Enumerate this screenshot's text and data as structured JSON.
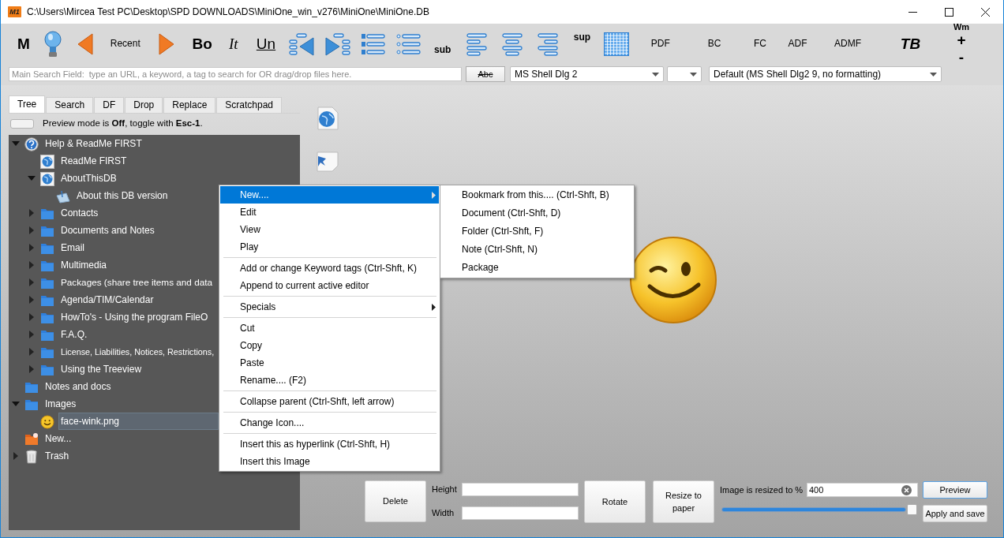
{
  "window": {
    "logo": "M1",
    "title": "C:\\Users\\Mircea Test PC\\Desktop\\SPD DOWNLOADS\\MiniOne_win_v276\\MiniOne\\MiniOne.DB"
  },
  "toolbar": {
    "buttons": [
      "M",
      "Recent",
      "Bo",
      "It",
      "Un",
      "sub",
      "sup",
      "PDF",
      "BC",
      "FC",
      "ADF",
      "ADMF",
      "TB",
      "Wm",
      "+",
      "-"
    ]
  },
  "search": {
    "placeholder": "Main Search Field:  type an URL, a keyword, a tag to search for OR drag/drop files here."
  },
  "format_bar": {
    "clear_button": "Abc",
    "font": "MS Shell Dlg 2",
    "style": "Default (MS Shell Dlg2 9, no formatting)"
  },
  "tabs": [
    {
      "label": "Tree",
      "selected": true
    },
    {
      "label": "Search",
      "selected": false
    },
    {
      "label": "DF",
      "selected": false
    },
    {
      "label": "Drop",
      "selected": false
    },
    {
      "label": "Replace",
      "selected": false
    },
    {
      "label": "Scratchpad",
      "selected": false
    }
  ],
  "preview": {
    "on": false,
    "text": "Preview mode is **Off**, toggle with **Esc-1**."
  },
  "tree": [
    {
      "label": "Help & ReadMe FIRST",
      "kind": "help",
      "selected": false,
      "expanded": true,
      "children": [
        {
          "label": "ReadMe FIRST",
          "kind": "web",
          "selected": false
        },
        {
          "label": "AboutThisDB",
          "kind": "web",
          "selected": false,
          "expanded": true,
          "children": [
            {
              "label": "About this DB version",
              "kind": "note",
              "selected": false
            }
          ]
        },
        {
          "label": "Contacts",
          "kind": "folder",
          "selected": false,
          "expanded": false
        },
        {
          "label": "Documents and Notes",
          "kind": "folder",
          "selected": false,
          "expanded": false
        },
        {
          "label": "Email",
          "kind": "folder",
          "selected": false,
          "expanded": false
        },
        {
          "label": "Multimedia",
          "kind": "folder",
          "selected": false,
          "expanded": false
        },
        {
          "label": "Packages (share tree items and data",
          "kind": "folder",
          "selected": false,
          "expanded": false
        },
        {
          "label": "Agenda/TIM/Calendar",
          "kind": "folder",
          "selected": false,
          "expanded": false
        },
        {
          "label": "HowTo's - Using the program FileO",
          "kind": "folder",
          "selected": false,
          "expanded": false
        },
        {
          "label": "F.A.Q.",
          "kind": "folder",
          "selected": false,
          "expanded": false
        },
        {
          "label": "License, Liabilities, Notices, Restrictions,",
          "kind": "folder",
          "selected": false,
          "expanded": false
        },
        {
          "label": "Using the Treeview",
          "kind": "folder",
          "selected": false,
          "expanded": false
        }
      ]
    },
    {
      "label": "Notes and docs",
      "kind": "folder",
      "selected": false
    },
    {
      "label": "Images",
      "kind": "folder",
      "selected": false,
      "expanded": true,
      "children": [
        {
          "label": "face-wink.png",
          "kind": "image",
          "selected": true
        }
      ]
    },
    {
      "label": "New...",
      "kind": "new",
      "selected": false
    },
    {
      "label": "Trash",
      "kind": "trash",
      "selected": false,
      "expanded": false
    }
  ],
  "context_menu": {
    "sections": [
      [
        {
          "label": "New....",
          "selected": true,
          "submenu": true
        },
        {
          "label": "Edit",
          "selected": false,
          "submenu": false
        },
        {
          "label": "View",
          "selected": false,
          "submenu": false
        },
        {
          "label": "Play",
          "selected": false,
          "submenu": false
        }
      ],
      [
        {
          "label": "Add or change Keyword tags (Ctrl-Shft, K)",
          "selected": false,
          "submenu": false
        },
        {
          "label": "Append to current active editor",
          "selected": false,
          "submenu": false
        }
      ],
      [
        {
          "label": "Specials",
          "selected": false,
          "submenu": true
        }
      ],
      [
        {
          "label": "Cut",
          "selected": false,
          "submenu": false
        },
        {
          "label": "Copy",
          "selected": false,
          "submenu": false
        },
        {
          "label": "Paste",
          "selected": false,
          "submenu": false
        },
        {
          "label": "Rename.... (F2)",
          "selected": false,
          "submenu": false
        }
      ],
      [
        {
          "label": "Collapse parent (Ctrl-Shft, left arrow)",
          "selected": false,
          "submenu": false
        }
      ],
      [
        {
          "label": "Change Icon....",
          "selected": false,
          "submenu": false
        }
      ],
      [
        {
          "label": "Insert this as hyperlink (Ctrl-Shft, H)",
          "selected": false,
          "submenu": false
        },
        {
          "label": "Insert this Image",
          "selected": false,
          "submenu": false
        }
      ]
    ]
  },
  "submenu": {
    "items": [
      "Bookmark from this.... (Ctrl-Shft, B)",
      "Document (Ctrl-Shft, D)",
      "Folder (Ctrl-Shft, F)",
      "Note (Ctrl-Shft, N)",
      "Package"
    ]
  },
  "image_panel": {
    "delete": "Delete",
    "height_label": "Height",
    "width_label": "Width",
    "rotate": "Rotate",
    "resize_to_paper": "Resize to paper",
    "resize_label": "Image is resized to %",
    "resize_value": "400",
    "level": 1,
    "preview": "Preview",
    "apply": "Apply and save"
  }
}
